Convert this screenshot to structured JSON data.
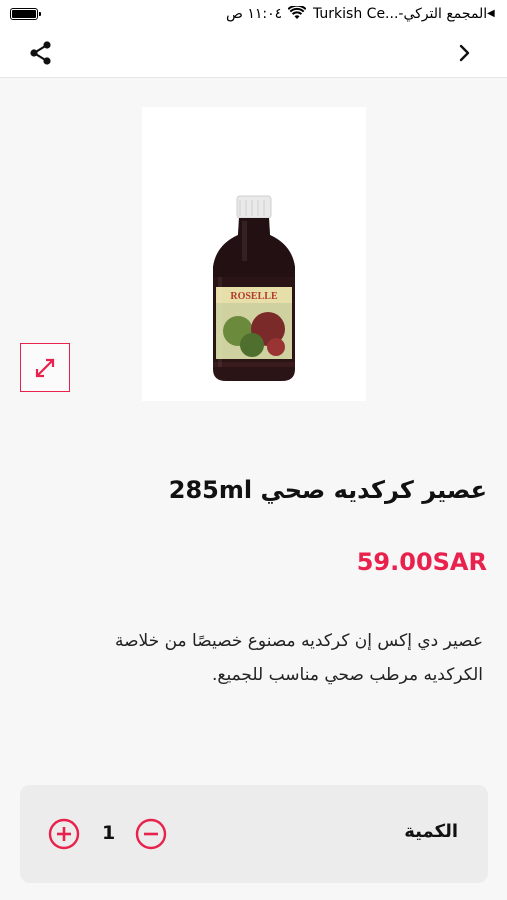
{
  "status_bar": {
    "time": "١١:٠٤ ص",
    "carrier": "Turkish Ce...-المجمع التركي",
    "play_icon": "play-icon",
    "icons": [
      "battery-icon",
      "wifi-icon"
    ]
  },
  "nav": {
    "share_icon": "share-icon",
    "back_icon": "chevron-right-icon"
  },
  "product": {
    "image_alt": "bottle-image",
    "title": "عصير كركديه صحي 285ml",
    "price": "59.00SAR",
    "description": "عصير دي إكس إن كركديه مصنوع خصيصًا من خلاصة الكركديه مرطب صحي مناسب للجميع."
  },
  "quantity": {
    "label": "الكمية",
    "value": "1"
  },
  "colors": {
    "accent": "#e8224d",
    "background": "#f7f7f7",
    "card": "#ececec"
  }
}
